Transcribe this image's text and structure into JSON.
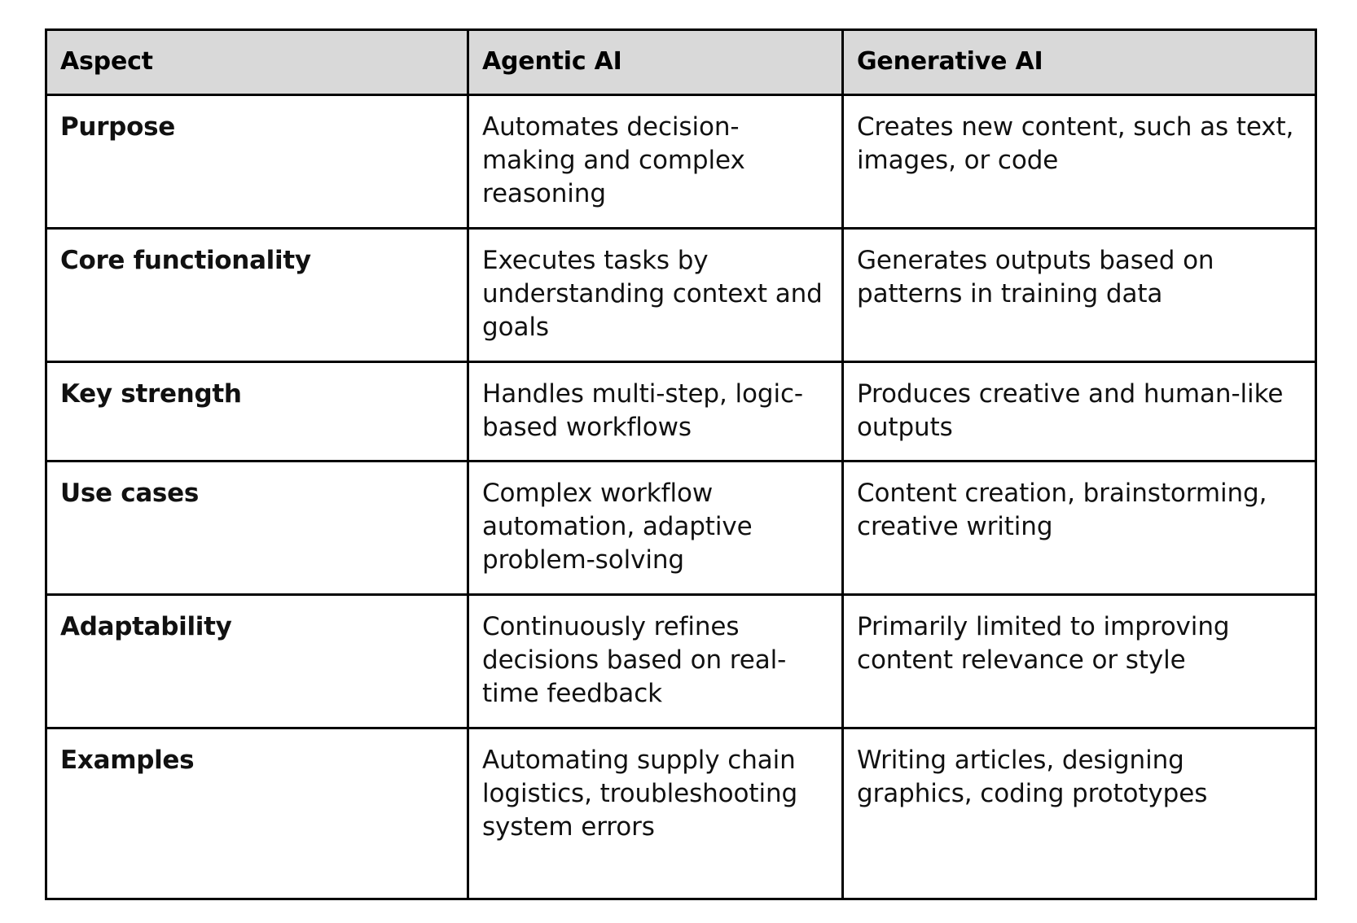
{
  "table": {
    "columns": [
      "Aspect",
      "Agentic AI",
      "Generative AI"
    ],
    "rows": [
      {
        "aspect": "Purpose",
        "agentic": "Automates decision-making and complex reasoning",
        "generative": "Creates new content, such as text, images, or code"
      },
      {
        "aspect": "Core functionality",
        "agentic": "Executes tasks by understanding context and goals",
        "generative": "Generates outputs based on patterns in training data"
      },
      {
        "aspect": "Key strength",
        "agentic": "Handles multi-step, logic-based workflows",
        "generative": "Produces creative and human-like outputs"
      },
      {
        "aspect": "Use cases",
        "agentic": "Complex workflow automation, adaptive problem-solving",
        "generative": "Content creation, brainstorming, creative writing"
      },
      {
        "aspect": "Adaptability",
        "agentic": "Continuously refines decisions based on real-time feedback",
        "generative": "Primarily limited to improving content relevance or style"
      },
      {
        "aspect": "Examples",
        "agentic": "Automating supply chain logistics, troubleshooting system errors",
        "generative": "Writing articles, designing graphics, coding prototypes"
      }
    ]
  },
  "colors": {
    "header_background": "#d9d9d9",
    "border": "#000000",
    "text": "#111111",
    "page_background": "#ffffff"
  }
}
